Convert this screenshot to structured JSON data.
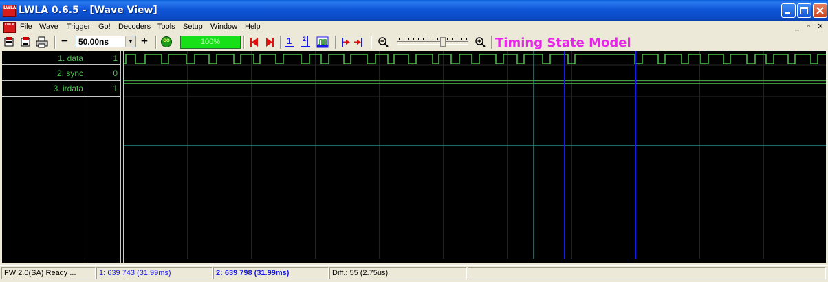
{
  "window": {
    "title": "LWLA 0.6.5 - [Wave View]",
    "app_icon_text": "LWLA"
  },
  "menubar": {
    "items": [
      "File",
      "Wave",
      "Trigger",
      "Go!",
      "Decoders",
      "Tools",
      "Setup",
      "Window",
      "Help"
    ],
    "mdi_buttons": [
      "_",
      "▫",
      "✕"
    ]
  },
  "toolbar": {
    "zoom_out_label": "−",
    "time_scale": "50.00ns",
    "zoom_in_label": "+",
    "go_label": "GO",
    "progress_text": "100%",
    "progress_fraction": 1.0,
    "marker1_label": "1",
    "marker2_label": "2",
    "slider_fraction": 0.63,
    "mode_label": "Timing State Model",
    "mode_color": "#e626e6"
  },
  "signals": [
    {
      "name": "1. data",
      "value": "1"
    },
    {
      "name": "2. sync",
      "value": "0"
    },
    {
      "name": "3. irdata",
      "value": "1"
    }
  ],
  "colors": {
    "trace": "#4ec24e",
    "cursor": "#1a1ae6",
    "marker": "#2aa8a0",
    "background": "#000000",
    "grid": "#444444",
    "progress": "#18e018"
  },
  "status": {
    "firmware": "FW 2.0(SA) Ready ...",
    "marker1": "1: 639 743  (31.99ms)",
    "marker2": "2: 639 798  (31.99ms)",
    "diff": "Diff.: 55  (2.75us)"
  }
}
